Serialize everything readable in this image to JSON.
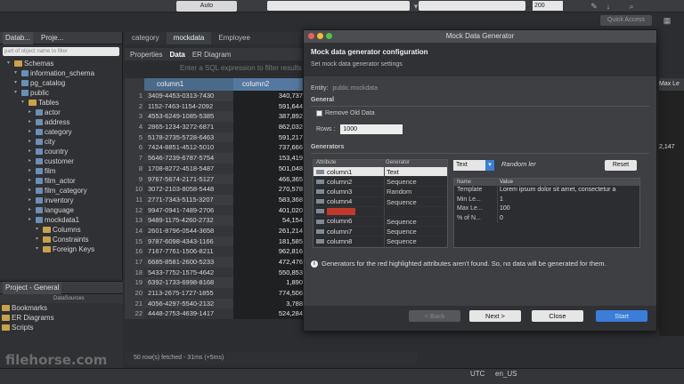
{
  "toolbar": {
    "auto_label": "Auto",
    "number_value": "200",
    "quick_access": "Quick Access"
  },
  "left_panel": {
    "tabs": [
      "Datab...",
      "Proje..."
    ],
    "filter_placeholder": "part of object name to filter",
    "tree": [
      {
        "label": "Schemas",
        "indent": 1,
        "kind": "folder"
      },
      {
        "label": "information_schema",
        "indent": 2,
        "kind": "db"
      },
      {
        "label": "pg_catalog",
        "indent": 2,
        "kind": "db"
      },
      {
        "label": "public",
        "indent": 2,
        "kind": "db"
      },
      {
        "label": "Tables",
        "indent": 3,
        "kind": "folder"
      },
      {
        "label": "actor",
        "indent": 4,
        "kind": "table"
      },
      {
        "label": "address",
        "indent": 4,
        "kind": "table"
      },
      {
        "label": "category",
        "indent": 4,
        "kind": "table"
      },
      {
        "label": "city",
        "indent": 4,
        "kind": "table"
      },
      {
        "label": "country",
        "indent": 4,
        "kind": "table"
      },
      {
        "label": "customer",
        "indent": 4,
        "kind": "table"
      },
      {
        "label": "film",
        "indent": 4,
        "kind": "table"
      },
      {
        "label": "film_actor",
        "indent": 4,
        "kind": "table"
      },
      {
        "label": "film_category",
        "indent": 4,
        "kind": "table"
      },
      {
        "label": "inventory",
        "indent": 4,
        "kind": "table"
      },
      {
        "label": "language",
        "indent": 4,
        "kind": "table"
      },
      {
        "label": "mockdata1",
        "indent": 4,
        "kind": "table"
      },
      {
        "label": "Columns",
        "indent": 5,
        "kind": "folder"
      },
      {
        "label": "Constraints",
        "indent": 5,
        "kind": "folder"
      },
      {
        "label": "Foreign Keys",
        "indent": 5,
        "kind": "folder"
      }
    ]
  },
  "project_panel": {
    "title": "Project - General",
    "sub_headers": [
      "",
      "DataSources"
    ],
    "items": [
      "Bookmarks",
      "ER Diagrams",
      "Scripts"
    ]
  },
  "editor": {
    "tabs": [
      "category",
      "mockdata",
      "Employee"
    ],
    "subtabs": [
      "Properties",
      "Data",
      "ER Diagram"
    ],
    "filter_placeholder": "Enter a SQL expression to filter results",
    "columns": [
      "column1",
      "column2"
    ],
    "rows": [
      {
        "n": "1",
        "c1": "3409-4453-0313-7430",
        "c2": "340,737"
      },
      {
        "n": "2",
        "c1": "1152-7463-1154-2092",
        "c2": "591,644"
      },
      {
        "n": "3",
        "c1": "4553-6249-1085-5385",
        "c2": "387,892"
      },
      {
        "n": "4",
        "c1": "2865-1234-3272-6871",
        "c2": "862,032"
      },
      {
        "n": "5",
        "c1": "5178-2735-5728-6463",
        "c2": "591,217"
      },
      {
        "n": "6",
        "c1": "7424-8851-4512-5010",
        "c2": "737,666"
      },
      {
        "n": "7",
        "c1": "5646-7239-6787-5754",
        "c2": "153,419"
      },
      {
        "n": "8",
        "c1": "1708-8272-4518-5487",
        "c2": "501,048"
      },
      {
        "n": "9",
        "c1": "9767-5674-2171-5127",
        "c2": "466,365"
      },
      {
        "n": "10",
        "c1": "3072-2103-8058-5448",
        "c2": "270,578"
      },
      {
        "n": "11",
        "c1": "2771-7343-5115-3207",
        "c2": "583,368"
      },
      {
        "n": "12",
        "c1": "9947-0941-7489-2706",
        "c2": "401,020"
      },
      {
        "n": "13",
        "c1": "9489-1175-4260-2732",
        "c2": "54,154"
      },
      {
        "n": "14",
        "c1": "2601-8796-0544-3658",
        "c2": "261,214"
      },
      {
        "n": "15",
        "c1": "9787-6098-4343-1166",
        "c2": "181,585"
      },
      {
        "n": "16",
        "c1": "7167-7761-1506-8211",
        "c2": "962,816"
      },
      {
        "n": "17",
        "c1": "6685-8581-2600-5233",
        "c2": "472,476"
      },
      {
        "n": "18",
        "c1": "5433-7752-1575-4642",
        "c2": "550,853"
      },
      {
        "n": "19",
        "c1": "6392-1733-6998-8168",
        "c2": "1,890"
      },
      {
        "n": "20",
        "c1": "2113-2675-1727-1855",
        "c2": "774,506"
      },
      {
        "n": "21",
        "c1": "4056-4297-5540-2132",
        "c2": "3,788"
      },
      {
        "n": "22",
        "c1": "4448-2753-4639-1417",
        "c2": "524,284"
      }
    ],
    "right_col_header": "Max Le",
    "right_col_value": "2,147",
    "status": "50 row(s) fetched - 31ms (+5ms)"
  },
  "status_bar": {
    "timezone": "UTC",
    "locale": "en_US"
  },
  "watermark": "filehorse.com",
  "dialog": {
    "title": "Mock Data Generator",
    "header_title": "Mock data generator configuration",
    "header_subtitle": "Set mock data generator settings",
    "entity_label": "Entity:",
    "entity_value": "public.mockdata",
    "general_label": "General",
    "remove_old_data": "Remove Old Data",
    "rows_label": "Rows :",
    "rows_value": "1000",
    "generators_label": "Generators",
    "gen_table_headers": [
      "Attribute",
      "Generator"
    ],
    "generators": [
      {
        "attr": "column1",
        "gen": "Text",
        "selected": true
      },
      {
        "attr": "column2",
        "gen": "Sequence"
      },
      {
        "attr": "column3",
        "gen": "Random"
      },
      {
        "attr": "column4",
        "gen": "Sequence"
      },
      {
        "attr": "",
        "gen": "",
        "red": true
      },
      {
        "attr": "column6",
        "gen": "Sequence"
      },
      {
        "attr": "column7",
        "gen": "Sequence"
      },
      {
        "attr": "column8",
        "gen": "Sequence"
      }
    ],
    "type_select": "Text",
    "generator_name": "Random ler",
    "reset_label": "Reset",
    "prop_headers": [
      "Name",
      "Value"
    ],
    "props": [
      {
        "name": "Template",
        "value": "Lorem ipsum dolor sit amet, consectetur a"
      },
      {
        "name": "Min Le...",
        "value": "1"
      },
      {
        "name": "Max Le...",
        "value": "100"
      },
      {
        "name": "% of N...",
        "value": "0"
      }
    ],
    "warning": "Generators for the red highlighted attributes aren't found. So, no data will be generated for them.",
    "buttons": {
      "back": "< Back",
      "next": "Next >",
      "close": "Close",
      "start": "Start"
    }
  }
}
